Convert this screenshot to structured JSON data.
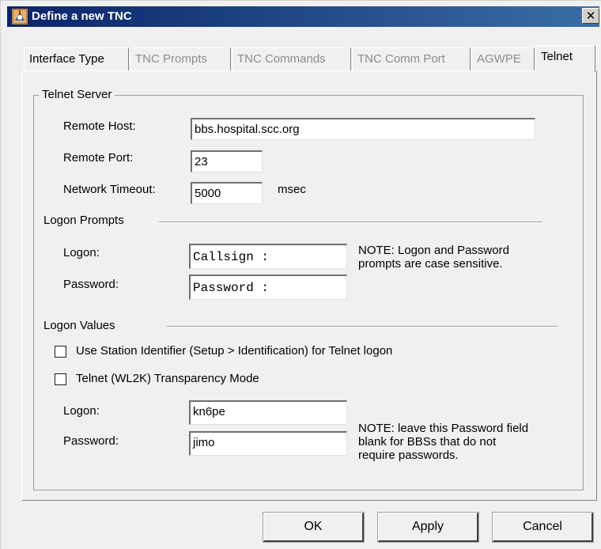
{
  "window": {
    "title": "Define a new TNC",
    "close_glyph": "✕",
    "icon": "tnc-app-icon"
  },
  "tabs": [
    {
      "label": "Interface Type",
      "state": "enabled"
    },
    {
      "label": "TNC Prompts",
      "state": "disabled"
    },
    {
      "label": "TNC Commands",
      "state": "disabled"
    },
    {
      "label": "TNC Comm Port",
      "state": "disabled"
    },
    {
      "label": "AGWPE",
      "state": "disabled"
    },
    {
      "label": "Telnet",
      "state": "active"
    }
  ],
  "telnet_server": {
    "group_label": "Telnet Server",
    "remote_host_label": "Remote Host:",
    "remote_host_value": "bbs.hospital.scc.org",
    "remote_port_label": "Remote Port:",
    "remote_port_value": "23",
    "timeout_label": "Network Timeout:",
    "timeout_value": "5000",
    "timeout_unit": "msec"
  },
  "logon_prompts": {
    "section_label": "Logon Prompts",
    "logon_label": "Logon:",
    "logon_value": "Callsign :",
    "password_label": "Password:",
    "password_value": "Password :",
    "note_line1": "NOTE:  Logon and Password",
    "note_line2": "prompts are case sensitive."
  },
  "logon_values": {
    "section_label": "Logon Values",
    "use_station_id_label": "Use Station Identifier (Setup > Identification) for Telnet logon",
    "use_station_id_checked": false,
    "transparency_label": "Telnet (WL2K) Transparency Mode",
    "transparency_checked": false,
    "logon_label": "Logon:",
    "logon_value": "kn6pe",
    "password_label": "Password:",
    "password_value": "jimo",
    "note_line1": "NOTE: leave this Password field",
    "note_line2": "blank for BBSs that do not",
    "note_line3": "require passwords."
  },
  "buttons": {
    "ok": "OK",
    "apply": "Apply",
    "cancel": "Cancel"
  },
  "colors": {
    "titlebar": "#0a246a",
    "dialog_bg": "#f0f0f0",
    "disabled_text": "#8c8c8c"
  }
}
